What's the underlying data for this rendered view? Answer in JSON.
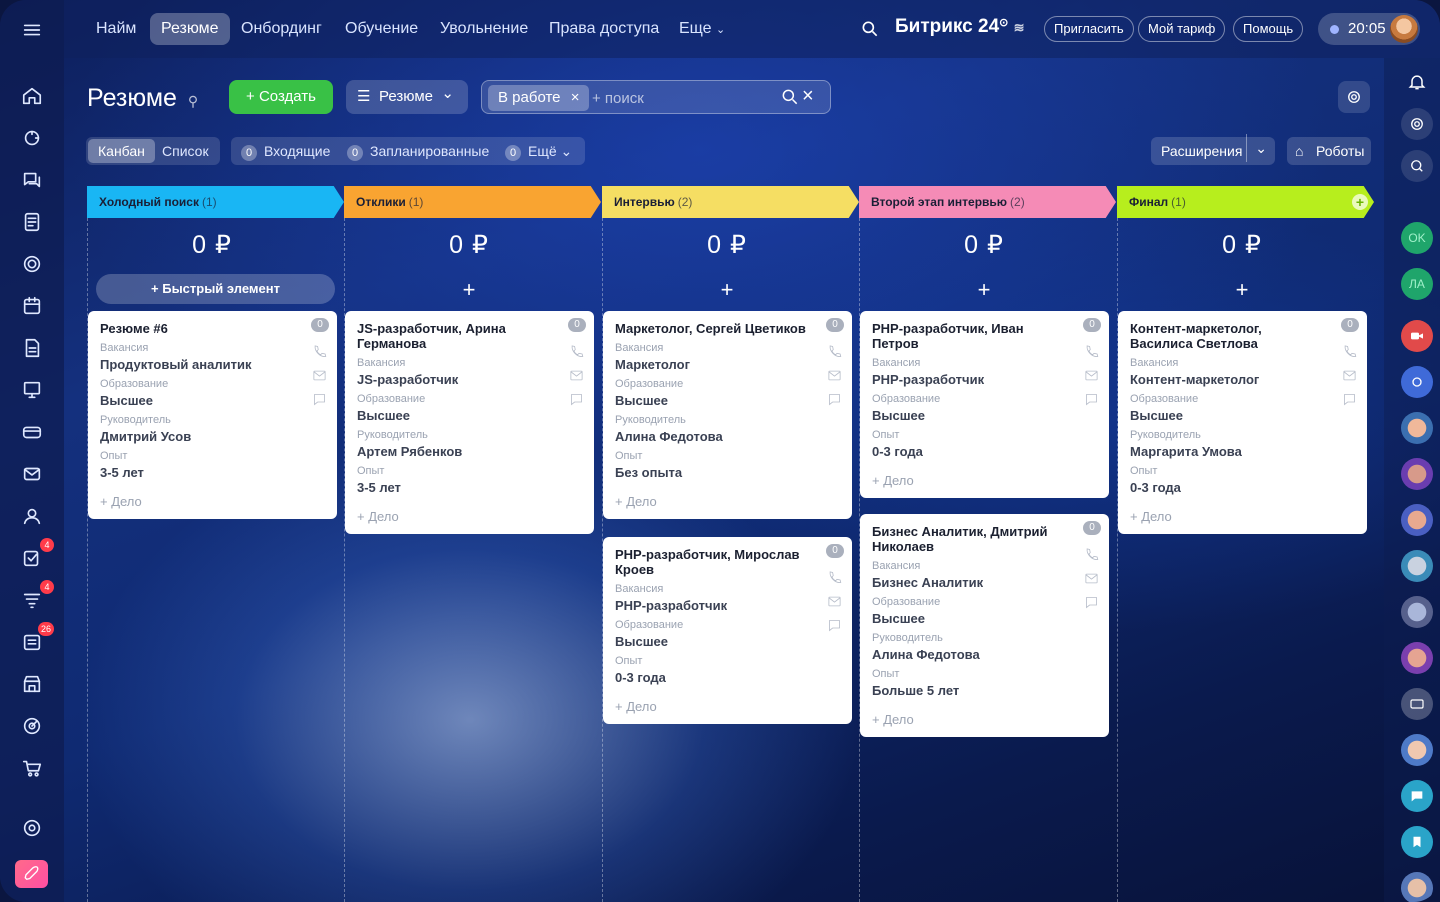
{
  "nav": {
    "items": [
      "Найм",
      "Резюме",
      "Онбординг",
      "Обучение",
      "Увольнение",
      "Права доступа",
      "Еще"
    ],
    "active_index": 1,
    "brand": "Битрикс 24",
    "invite": "Пригласить",
    "tariff": "Мой тариф",
    "help": "Помощь",
    "time": "20:05"
  },
  "sidebar": {
    "icons": [
      "home-icon",
      "puzzle-icon",
      "chat-icon",
      "feed-icon",
      "target-icon",
      "calendar-icon",
      "document-icon",
      "presentation-icon",
      "card-icon",
      "mail-icon",
      "users-icon",
      "tasks-icon",
      "funnel-icon",
      "list-icon",
      "store-icon",
      "sale-icon",
      "cart-icon",
      "settings-icon",
      "rocket-icon"
    ],
    "badges": {
      "tasks-icon": "4",
      "funnel-icon": "4",
      "list-icon": "26"
    }
  },
  "rightrail": {
    "items": [
      "bell-icon",
      "bell-2-icon",
      "search-chat-icon",
      "OK",
      "ЛА",
      "video-icon",
      "avatar",
      "avatar",
      "avatar",
      "avatar",
      "avatar",
      "avatar",
      "avatar",
      "card-icon",
      "avatar",
      "chat-icon",
      "bookmark-icon",
      "avatar"
    ]
  },
  "toolbar": {
    "title": "Резюме",
    "create": "Создать",
    "filter": "Резюме",
    "chip": "В работе",
    "search_placeholder": "+ поиск",
    "view_kanban": "Канбан",
    "view_list": "Список",
    "incoming_count": "0",
    "incoming": "Входящие",
    "planned_count": "0",
    "planned": "Запланированные",
    "more_count": "0",
    "more": "Ещё",
    "extensions": "Расширения",
    "robots": "Роботы"
  },
  "labels": {
    "vacancy": "Вакансия",
    "education": "Образование",
    "manager": "Руководитель",
    "experience": "Опыт",
    "add_deal": "+ Дело",
    "quick_add": "Быстрый элемент"
  },
  "columns": [
    {
      "title": "Холодный поиск",
      "count": "(1)",
      "color": "#19b6f4",
      "sum": "0 ₽",
      "cards": [
        {
          "title": "Резюме #6",
          "badge": "0",
          "vacancy": "Продуктовый аналитик",
          "education": "Высшее",
          "manager": "Дмитрий Усов",
          "experience": "3-5 лет"
        }
      ]
    },
    {
      "title": "Отклики",
      "count": "(1)",
      "color": "#f9a431",
      "sum": "0 ₽",
      "cards": [
        {
          "title": "JS-разработчик, Арина Германова",
          "badge": "0",
          "vacancy": "JS-разработчик",
          "education": "Высшее",
          "manager": "Артем Рябенков",
          "experience": "3-5 лет"
        }
      ]
    },
    {
      "title": "Интервью",
      "count": "(2)",
      "color": "#f5de63",
      "sum": "0 ₽",
      "cards": [
        {
          "title": "Маркетолог, Сергей Цветиков",
          "badge": "0",
          "vacancy": "Маркетолог",
          "education": "Высшее",
          "manager": "Алина Федотова",
          "experience": "Без опыта"
        },
        {
          "title": "PHP-разработчик, Мирослав Кроев",
          "badge": "0",
          "vacancy": "PHP-разработчик",
          "education": "Высшее",
          "experience": "0-3 года"
        }
      ]
    },
    {
      "title": "Второй этап интервью",
      "count": "(2)",
      "color": "#f58bb6",
      "sum": "0 ₽",
      "cards": [
        {
          "title": "PHP-разработчик, Иван Петров",
          "badge": "0",
          "vacancy": "PHP-разработчик",
          "education": "Высшее",
          "experience": "0-3 года"
        },
        {
          "title": "Бизнес Аналитик, Дмитрий Николаев",
          "badge": "0",
          "vacancy": "Бизнес Аналитик",
          "education": "Высшее",
          "manager": "Алина Федотова",
          "experience": "Больше 5 лет"
        }
      ]
    },
    {
      "title": "Финал",
      "count": "(1)",
      "color": "#b7ee1d",
      "sum": "0 ₽",
      "cards": [
        {
          "title": "Контент-маркетолог, Василиса Светлова",
          "badge": "0",
          "vacancy": "Контент-маркетолог",
          "education": "Высшее",
          "manager": "Маргарита Умова",
          "experience": "0-3 года"
        }
      ]
    }
  ]
}
